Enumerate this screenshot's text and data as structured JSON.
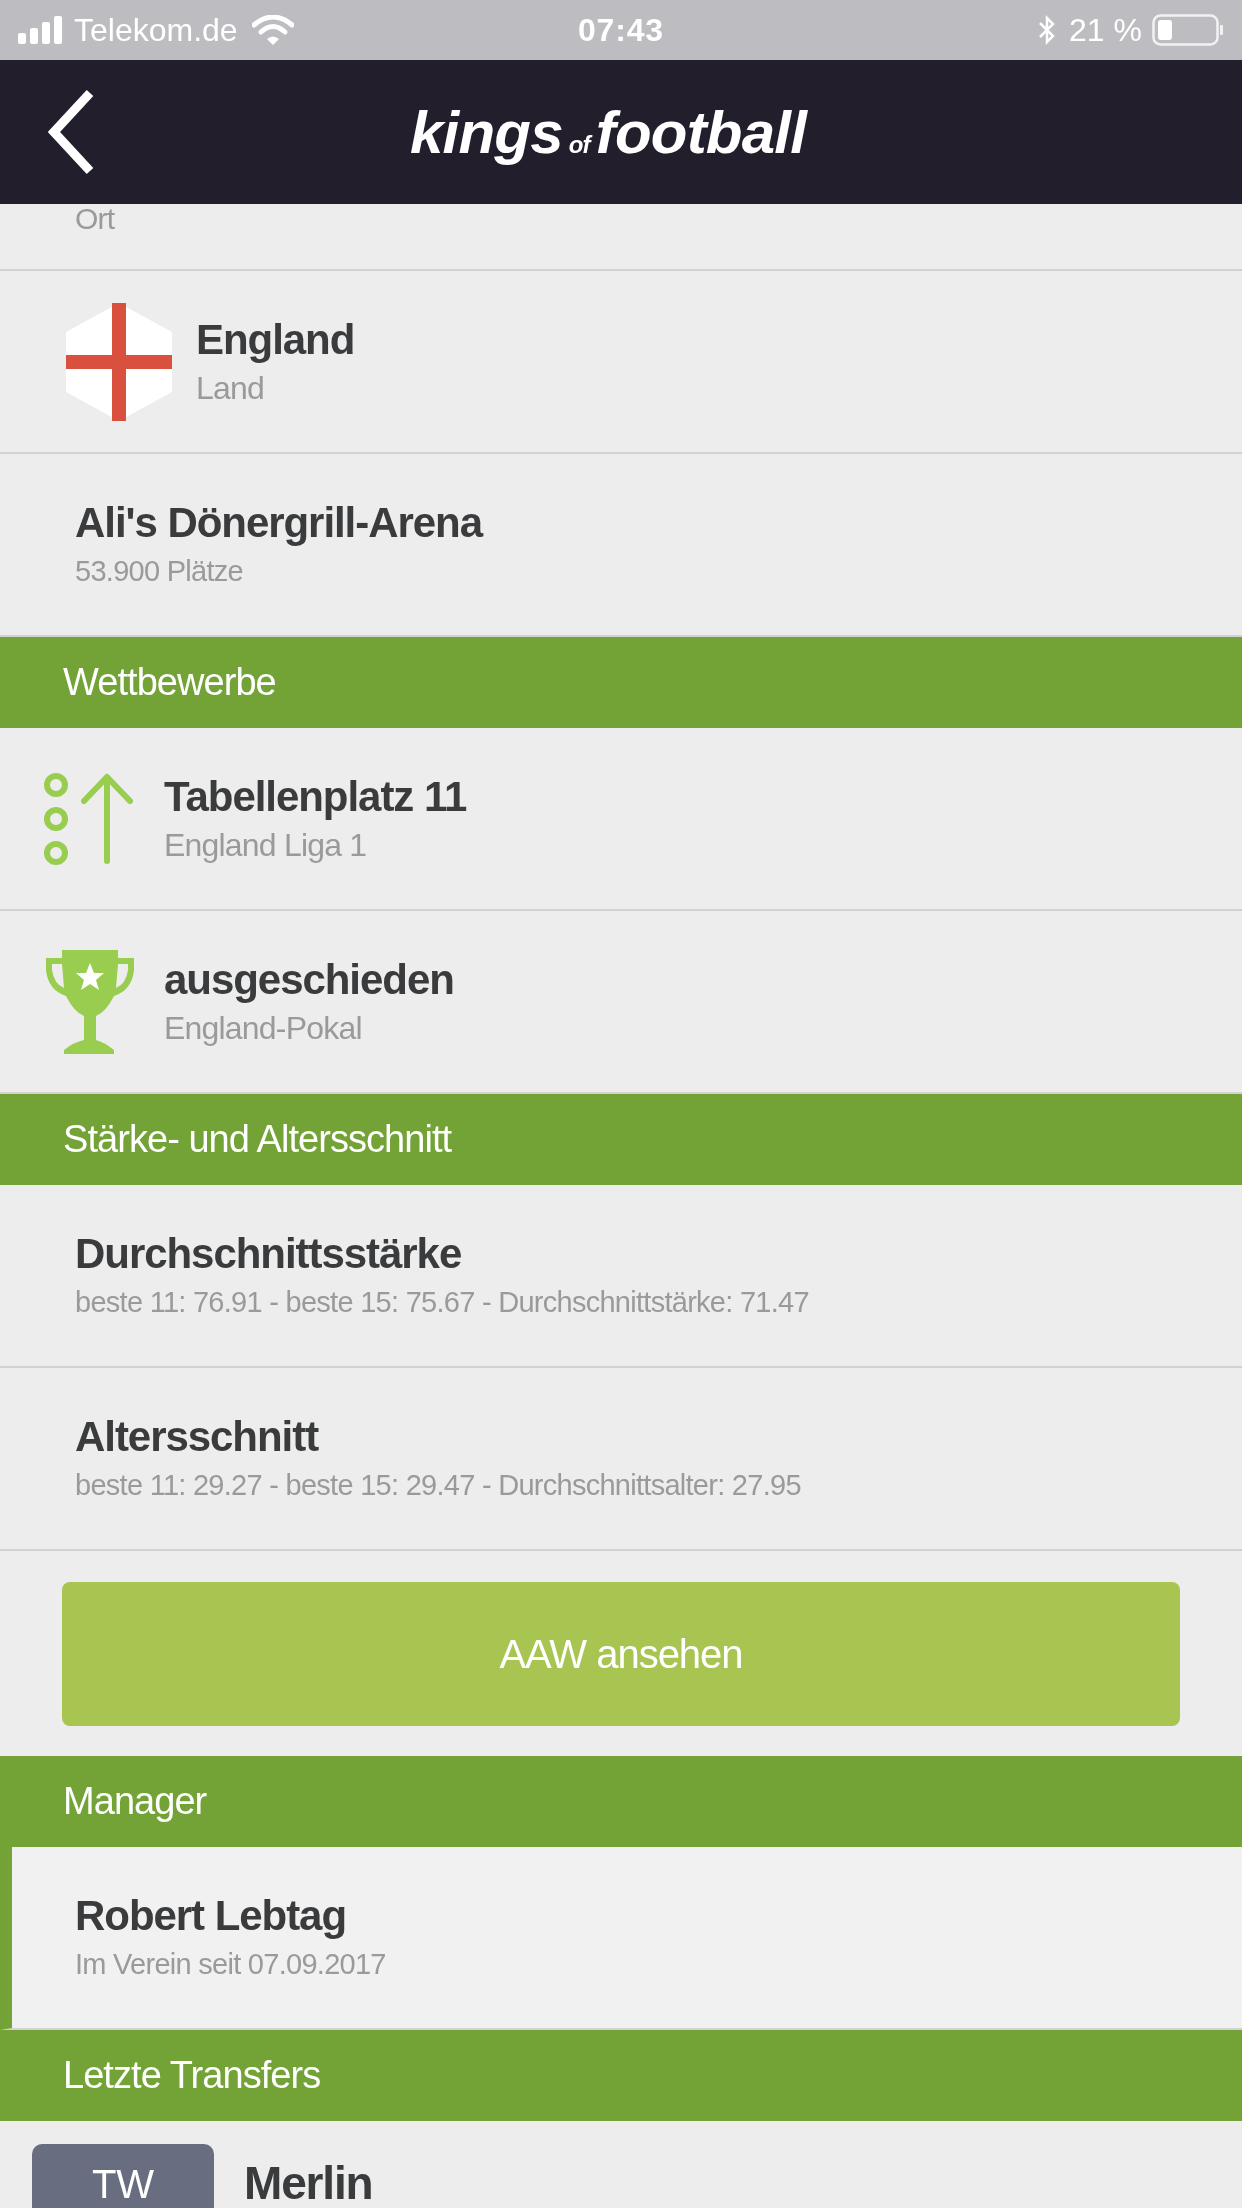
{
  "status_bar": {
    "carrier": "Telekom.de",
    "time": "07:43",
    "battery": "21 %"
  },
  "header": {
    "logo_main": "kings",
    "logo_small": "of",
    "logo_end": "football"
  },
  "blocks": [
    {
      "kind": "partial",
      "subtitle": "Ort"
    },
    {
      "kind": "flag",
      "title": "England",
      "subtitle": "Land",
      "highlighted": false
    },
    {
      "kind": "row",
      "title": "Ali's Dönergrill-Arena",
      "subtitle": "53.900 Plätze",
      "highlighted": false
    },
    {
      "kind": "section",
      "title": "Wettbewerbe"
    },
    {
      "kind": "rank",
      "title": "Tabellenplatz 11",
      "subtitle": "England Liga 1",
      "highlighted": false
    },
    {
      "kind": "trophy",
      "title": "ausgeschieden",
      "subtitle": "England-Pokal",
      "highlighted": false
    },
    {
      "kind": "section",
      "title": "Stärke- und Altersschnitt"
    },
    {
      "kind": "row",
      "title": "Durchschnittsstärke",
      "subtitle": "beste 11: 76.91 - beste 15: 75.67 - Durchschnittstärke: 71.47",
      "highlighted": false
    },
    {
      "kind": "row",
      "title": "Altersschnitt",
      "subtitle": "beste 11: 29.27 - beste 15: 29.47 - Durchschnittsalter: 27.95",
      "highlighted": false
    },
    {
      "kind": "button",
      "label": "AAW ansehen"
    },
    {
      "kind": "section",
      "title": "Manager"
    },
    {
      "kind": "row",
      "title": "Robert Lebtag",
      "subtitle": "Im Verein seit 07.09.2017",
      "highlighted": true
    },
    {
      "kind": "section",
      "title": "Letzte Transfers"
    },
    {
      "kind": "transfer",
      "badge": "TW",
      "title": "Merlin"
    }
  ]
}
